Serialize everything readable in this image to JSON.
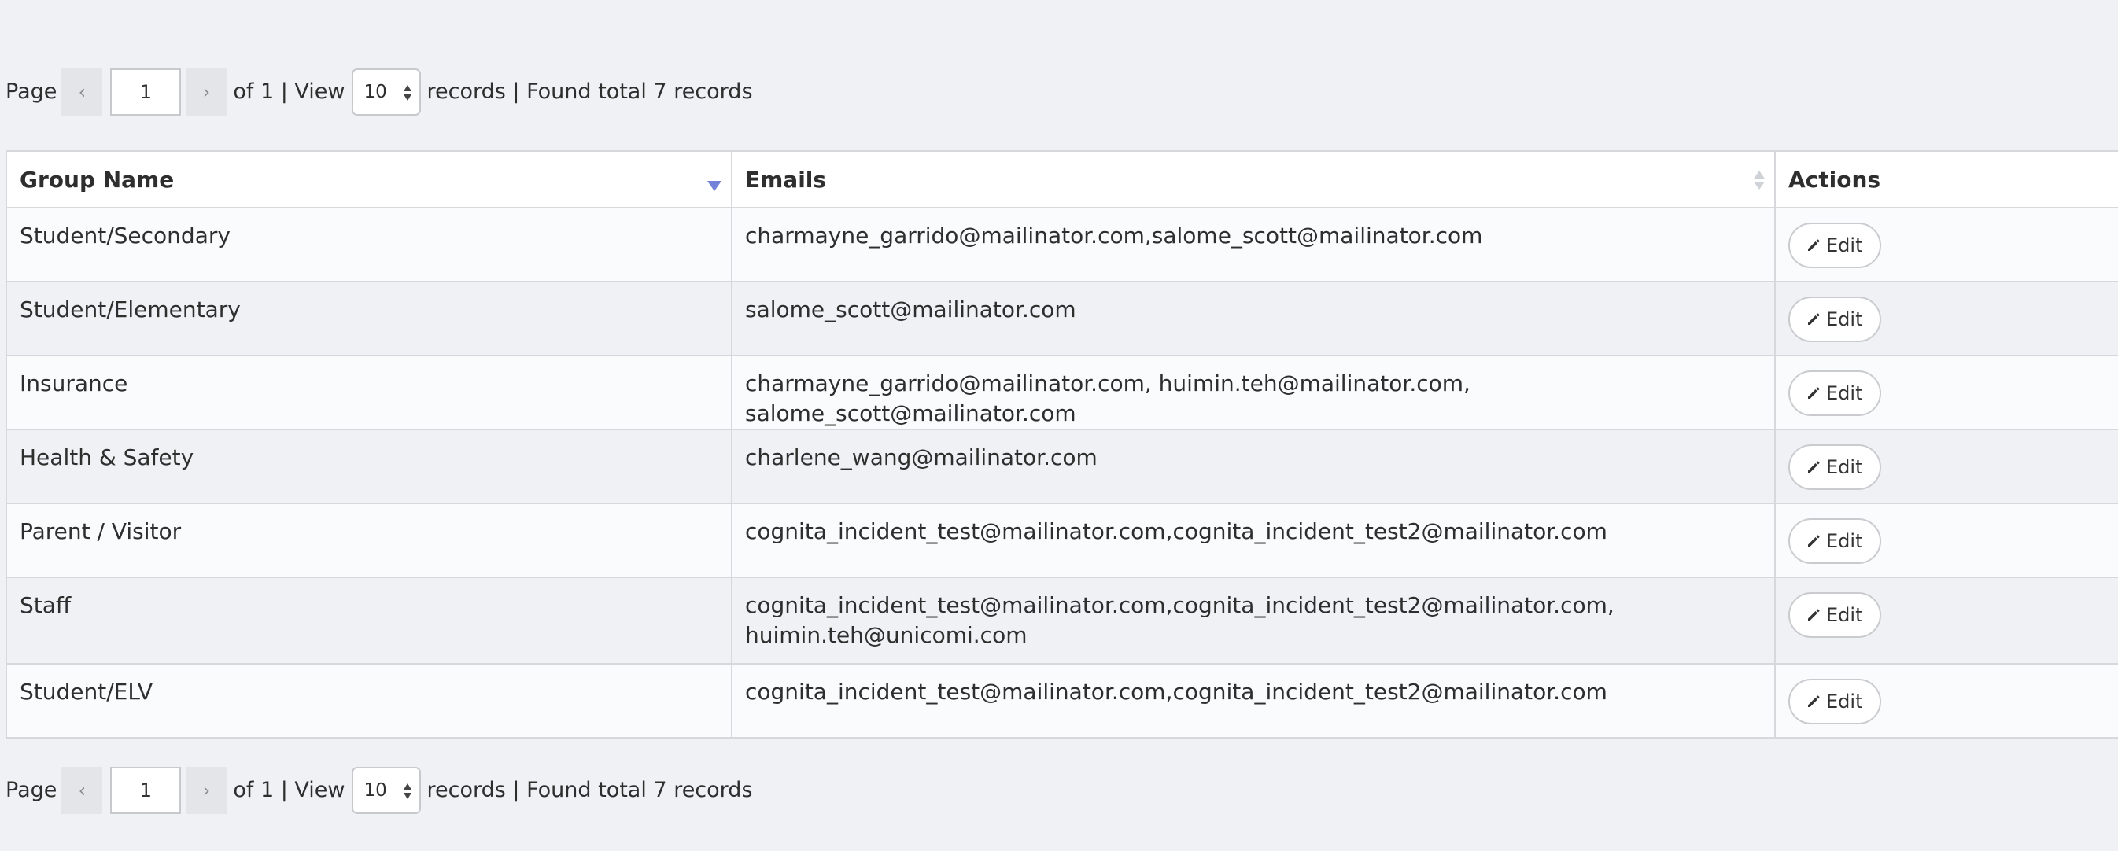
{
  "pagination": {
    "page_label": "Page",
    "prev_icon": "‹",
    "next_icon": "›",
    "current_page": "1",
    "of_view_label": "of 1 | View",
    "page_size": "10",
    "records_label": "records | Found total 7 records"
  },
  "table": {
    "columns": [
      "Group Name",
      "Emails",
      "Actions"
    ],
    "sort": {
      "column": "Group Name",
      "direction": "descending",
      "indicator_color": "#7382d8"
    },
    "rows": [
      {
        "group": "Student/Secondary",
        "emails": "charmayne_garrido@mailinator.com,salome_scott@mailinator.com",
        "action": "Edit"
      },
      {
        "group": "Student/Elementary",
        "emails": "salome_scott@mailinator.com",
        "action": "Edit"
      },
      {
        "group": "Insurance",
        "emails": "charmayne_garrido@mailinator.com, huimin.teh@mailinator.com, salome_scott@mailinator.com",
        "action": "Edit"
      },
      {
        "group": "Health & Safety",
        "emails": "charlene_wang@mailinator.com",
        "action": "Edit"
      },
      {
        "group": "Parent / Visitor",
        "emails": "cognita_incident_test@mailinator.com,cognita_incident_test2@mailinator.com",
        "action": "Edit"
      },
      {
        "group": "Staff",
        "emails_line1": "cognita_incident_test@mailinator.com,cognita_incident_test2@mailinator.com,",
        "emails_line2": "huimin.teh@unicomi.com",
        "action": "Edit"
      },
      {
        "group": "Student/ELV",
        "emails": "cognita_incident_test@mailinator.com,cognita_incident_test2@mailinator.com",
        "action": "Edit"
      }
    ]
  },
  "icons": {
    "edit": "pencil-icon",
    "sort": "sort-desc-icon"
  }
}
